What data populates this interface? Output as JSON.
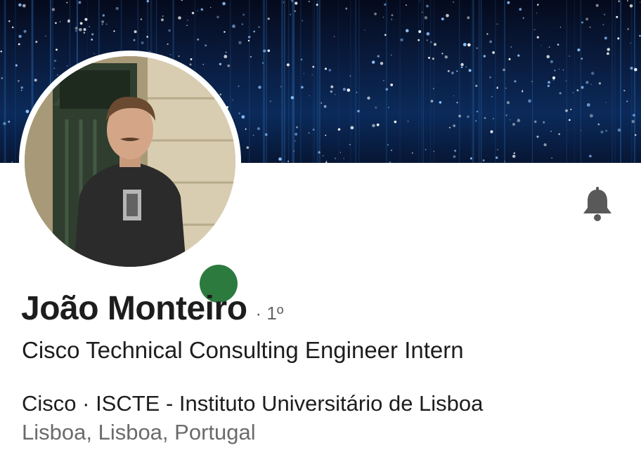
{
  "profile": {
    "name": "João Monteiro",
    "connection_degree": "· 1º",
    "headline": "Cisco Technical Consulting Engineer Intern",
    "company_education": "Cisco · ISCTE - Instituto Universitário de Lisboa",
    "location": "Lisboa, Lisboa, Portugal"
  },
  "status": {
    "online": true,
    "color": "#2d7a3e"
  },
  "icons": {
    "notify": "bell-icon"
  },
  "colors": {
    "banner": "#0b2a5a",
    "text_primary": "#1d1d1d",
    "text_secondary": "#6b6b6b"
  }
}
